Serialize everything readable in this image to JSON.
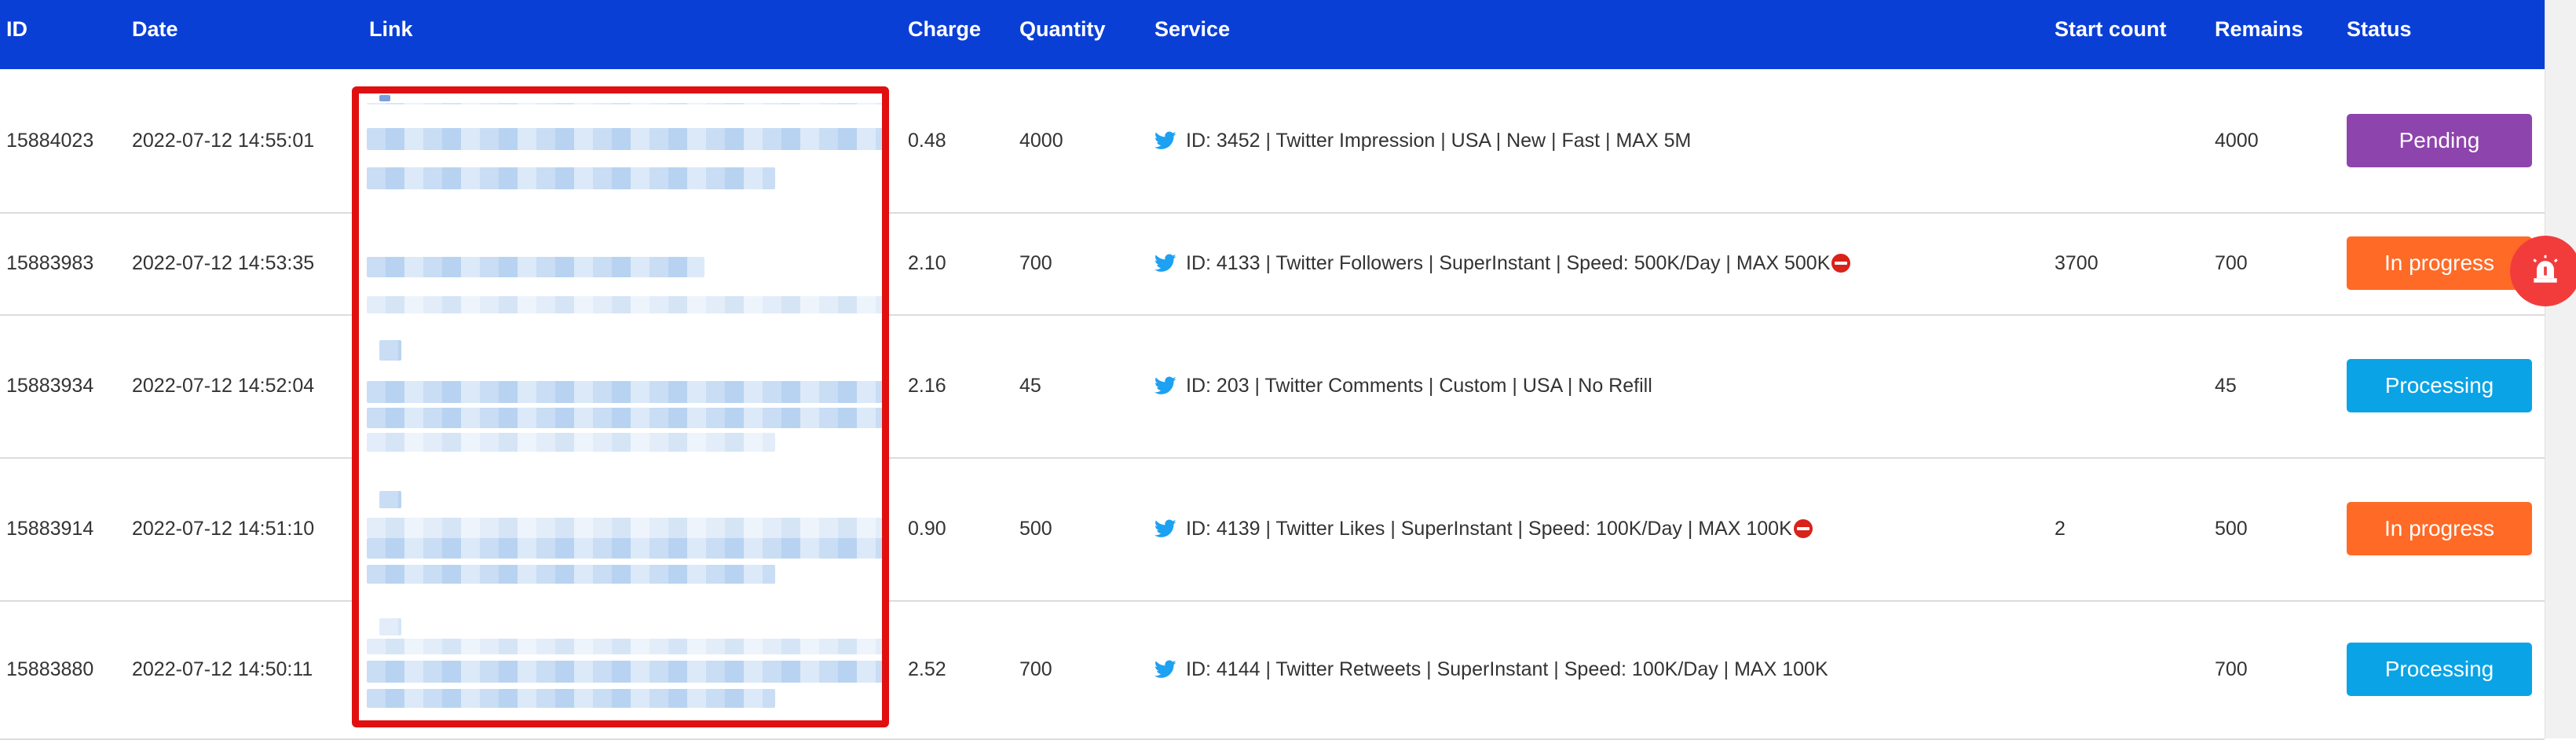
{
  "table": {
    "headers": {
      "id": "ID",
      "date": "Date",
      "link": "Link",
      "charge": "Charge",
      "quantity": "Quantity",
      "service": "Service",
      "start_count": "Start count",
      "remains": "Remains",
      "status": "Status"
    },
    "rows": [
      {
        "id": "15884023",
        "date": "2022-07-12 14:55:01",
        "charge": "0.48",
        "quantity": "4000",
        "service": "ID: 3452 | Twitter Impression | USA | New | Fast | MAX 5M",
        "service_stop_icon": false,
        "start_count": "",
        "remains": "4000",
        "status": "Pending",
        "status_color": "#8e44ad"
      },
      {
        "id": "15883983",
        "date": "2022-07-12 14:53:35",
        "charge": "2.10",
        "quantity": "700",
        "service": "ID: 4133 | Twitter Followers | SuperInstant | Speed: 500K/Day | MAX 500K",
        "service_stop_icon": true,
        "start_count": "3700",
        "remains": "700",
        "status": "In progress",
        "status_color": "#ff6a26"
      },
      {
        "id": "15883934",
        "date": "2022-07-12 14:52:04",
        "charge": "2.16",
        "quantity": "45",
        "service": "ID: 203 | Twitter Comments | Custom | USA | No Refill",
        "service_stop_icon": false,
        "start_count": "",
        "remains": "45",
        "status": "Processing",
        "status_color": "#0aa3e6"
      },
      {
        "id": "15883914",
        "date": "2022-07-12 14:51:10",
        "charge": "0.90",
        "quantity": "500",
        "service": "ID: 4139 | Twitter Likes | SuperInstant | Speed: 100K/Day | MAX 100K",
        "service_stop_icon": true,
        "start_count": "2",
        "remains": "500",
        "status": "In progress",
        "status_color": "#ff6a26"
      },
      {
        "id": "15883880",
        "date": "2022-07-12 14:50:11",
        "charge": "2.52",
        "quantity": "700",
        "service": "ID: 4144 | Twitter Retweets | SuperInstant | Speed: 100K/Day | MAX 100K",
        "service_stop_icon": false,
        "start_count": "",
        "remains": "700",
        "status": "Processing",
        "status_color": "#0aa3e6"
      }
    ]
  },
  "icons": {
    "service": "twitter-bird-icon",
    "warning": "no-entry-icon",
    "float_button": "alarm-siren-icon"
  },
  "colors": {
    "header_bg": "#0a3fd6",
    "redaction_frame": "#e01010",
    "twitter_blue": "#1da1f2",
    "float_button": "#f23c3c"
  }
}
